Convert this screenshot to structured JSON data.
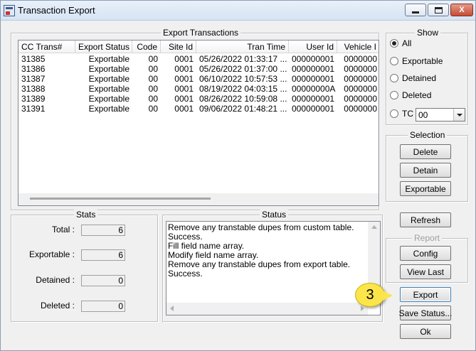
{
  "window": {
    "title": "Transaction Export",
    "close_glyph": "X"
  },
  "export_group": {
    "title": "Export Transactions",
    "columns": [
      "CC Trans#",
      "Export Status",
      "Code",
      "Site Id",
      "Tran Time",
      "User Id",
      "Vehicle I"
    ],
    "rows": [
      [
        "31385",
        "Exportable",
        "00",
        "0001",
        "05/26/2022 01:33:17 ...",
        "000000001",
        "0000000"
      ],
      [
        "31386",
        "Exportable",
        "00",
        "0001",
        "05/26/2022 01:37:00 ...",
        "000000001",
        "0000000"
      ],
      [
        "31387",
        "Exportable",
        "00",
        "0001",
        "06/10/2022 10:57:53 ...",
        "000000001",
        "0000000"
      ],
      [
        "31388",
        "Exportable",
        "00",
        "0001",
        "08/19/2022 04:03:15 ...",
        "00000000A",
        "0000000"
      ],
      [
        "31389",
        "Exportable",
        "00",
        "0001",
        "08/26/2022 10:59:08 ...",
        "000000001",
        "0000000"
      ],
      [
        "31391",
        "Exportable",
        "00",
        "0001",
        "09/06/2022 01:48:21 ...",
        "000000001",
        "0000000"
      ]
    ]
  },
  "show": {
    "title": "Show",
    "options": [
      {
        "label": "All",
        "selected": true
      },
      {
        "label": "Exportable",
        "selected": false
      },
      {
        "label": "Detained",
        "selected": false
      },
      {
        "label": "Deleted",
        "selected": false
      },
      {
        "label": "TC",
        "selected": false
      }
    ],
    "tc_value": "00"
  },
  "selection": {
    "title": "Selection",
    "delete_label": "Delete",
    "detain_label": "Detain",
    "exportable_label": "Exportable"
  },
  "refresh_label": "Refresh",
  "report": {
    "title": "Report",
    "config_label": "Config",
    "view_last_label": "View Last"
  },
  "export_label": "Export",
  "save_status_label": "Save Status...",
  "ok_label": "Ok",
  "stats": {
    "title": "Stats",
    "items": [
      {
        "label": "Total :",
        "value": "6"
      },
      {
        "label": "Exportable :",
        "value": "6"
      },
      {
        "label": "Detained :",
        "value": "0"
      },
      {
        "label": "Deleted :",
        "value": "0"
      }
    ]
  },
  "status": {
    "title": "Status",
    "lines": [
      "Remove any transtable dupes from custom table.",
      "Success.",
      "Fill field name array.",
      "Modify field name array.",
      "Remove any transtable dupes from export table.",
      "Success."
    ]
  },
  "callout": {
    "number": "3"
  }
}
